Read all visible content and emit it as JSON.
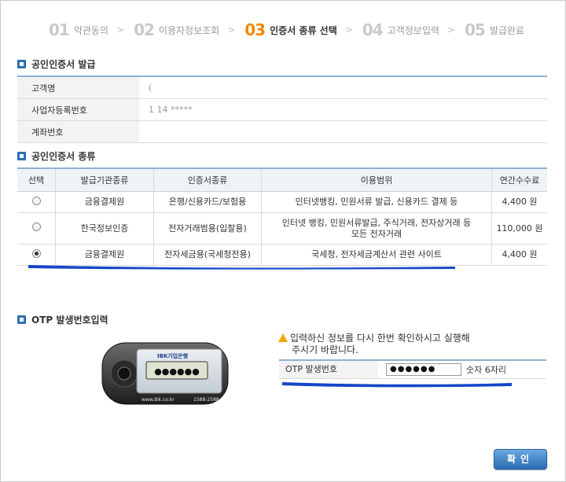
{
  "steps": [
    {
      "num": "01",
      "label": "약관동의",
      "active": false
    },
    {
      "num": "02",
      "label": "이용자정보조회",
      "active": false
    },
    {
      "num": "03",
      "label": "인증서 종류 선택",
      "active": true
    },
    {
      "num": "04",
      "label": "고객정보입력",
      "active": false
    },
    {
      "num": "05",
      "label": "발급완료",
      "active": false
    }
  ],
  "issue": {
    "title": "공인인증서 발급",
    "rows": [
      {
        "label": "고객명",
        "value": "(       "
      },
      {
        "label": "사업자등록번호",
        "value": "1   14   *****"
      },
      {
        "label": "계좌번호",
        "value": "                 "
      }
    ]
  },
  "kinds": {
    "title": "공인인증서 종류",
    "headers": [
      "선택",
      "발급기관종류",
      "인증서종류",
      "이용범위",
      "연간수수료"
    ],
    "rows": [
      {
        "selected": false,
        "org": "금융결제원",
        "type": "은행/신용카드/보험용",
        "scope": "인터넷뱅킹, 민원서류 발급, 신용카드 결제 등",
        "fee": "4,400 원"
      },
      {
        "selected": false,
        "org": "한국정보인증",
        "type": "전자거래범용(입찰용)",
        "scope": "인터넷 뱅킹, 민원서류발급, 주식거래, 전자상거래 등\n모든 전자거래",
        "fee": "110,000 원"
      },
      {
        "selected": true,
        "org": "금융결제원",
        "type": "전자세금용(국세청전용)",
        "scope": "국세청, 전자세금계산서 관련 사이트",
        "fee": "4,400 원"
      }
    ]
  },
  "otp": {
    "title": "OTP 발생번호입력",
    "warning_line1": "입력하신 정보를 다시 한번 확인하시고 실행해",
    "warning_line2": "주시기 바랍니다.",
    "field_label": "OTP 발생번호",
    "value": "●●●●●●",
    "suffix": "숫자 6자리",
    "device": {
      "brand": "IBK기업은행",
      "display": "●●●●●●",
      "url": "www.ibk.co.kr",
      "phone": "1588-2588"
    }
  },
  "confirm_label": "확인",
  "colors": {
    "active_step": "#f08a00",
    "accent": "#2f6fb4",
    "marker": "#1446c8"
  }
}
